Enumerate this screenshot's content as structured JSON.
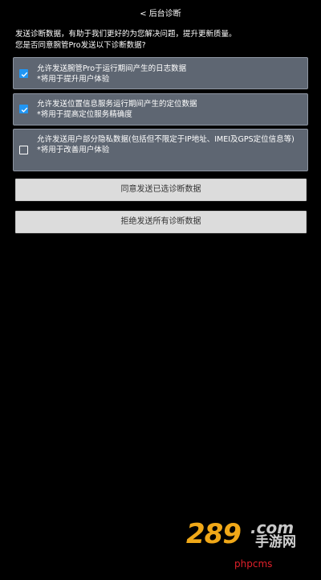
{
  "header": {
    "back_glyph": "<",
    "title": "后台诊断"
  },
  "intro": {
    "line1": "发送诊断数据，有助于我们更好的为您解决问题，提升更新质量。",
    "line2": "您是否同意腕管Pro发送以下诊断数据?"
  },
  "options": [
    {
      "checked": true,
      "title": "允许发送腕管Pro于运行期间产生的日志数据",
      "note": "*将用于提升用户体验"
    },
    {
      "checked": true,
      "title": "允许发送位置信息服务运行期间产生的定位数据",
      "note": "*将用于提高定位服务精确度"
    },
    {
      "checked": false,
      "title": "允许发送用户部分隐私数据(包括但不限定于IP地址、IMEI及GPS定位信息等)",
      "note": "*将用于改善用户体验"
    }
  ],
  "buttons": {
    "agree_label": "同意发送已选诊断数据",
    "reject_label": "拒绝发送所有诊断数据"
  },
  "watermark": {
    "logo_number": "289",
    "logo_domain": ".com",
    "logo_cn": "手游网",
    "bottom_text": "phpcms"
  },
  "colors": {
    "background": "#000000",
    "option_bg": "#5e6672",
    "checkbox_checked": "#2196f3",
    "button_bg": "#dcdcdc",
    "watermark_orange": "#f0a818",
    "watermark_red": "#e0202a"
  },
  "icons": {
    "back": "chevron-left-icon",
    "checked": "checkbox-checked-icon",
    "unchecked": "checkbox-unchecked-icon"
  }
}
